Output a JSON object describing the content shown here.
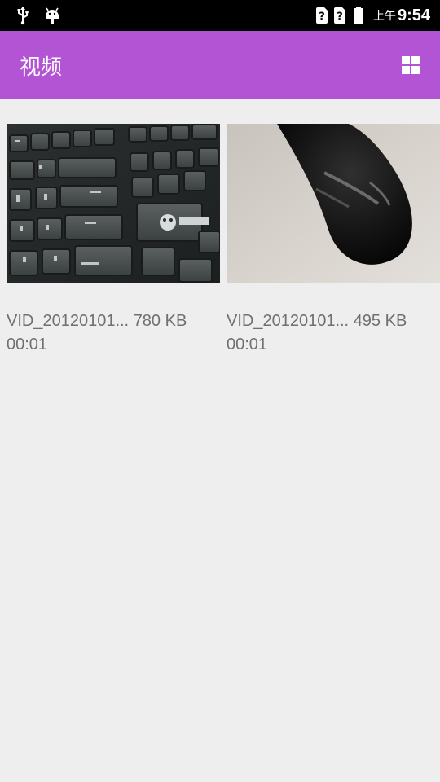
{
  "status_bar": {
    "ampm": "上午",
    "time": "9:54",
    "icons": [
      "usb-icon",
      "android-debug-icon",
      "sim-unknown-icon",
      "sim-unknown-icon",
      "battery-icon"
    ]
  },
  "app_bar": {
    "title": "视频",
    "view_toggle_icon": "grid-view-icon"
  },
  "videos": [
    {
      "name": "VID_20120101...",
      "size": "780 KB",
      "duration": "00:01",
      "thumbnail": "keyboard"
    },
    {
      "name": "VID_20120101...",
      "size": "495 KB",
      "duration": "00:01",
      "thumbnail": "mouse"
    }
  ],
  "colors": {
    "app_bar": "#b354d4",
    "background": "#eeeeee",
    "meta_text": "#707070"
  }
}
